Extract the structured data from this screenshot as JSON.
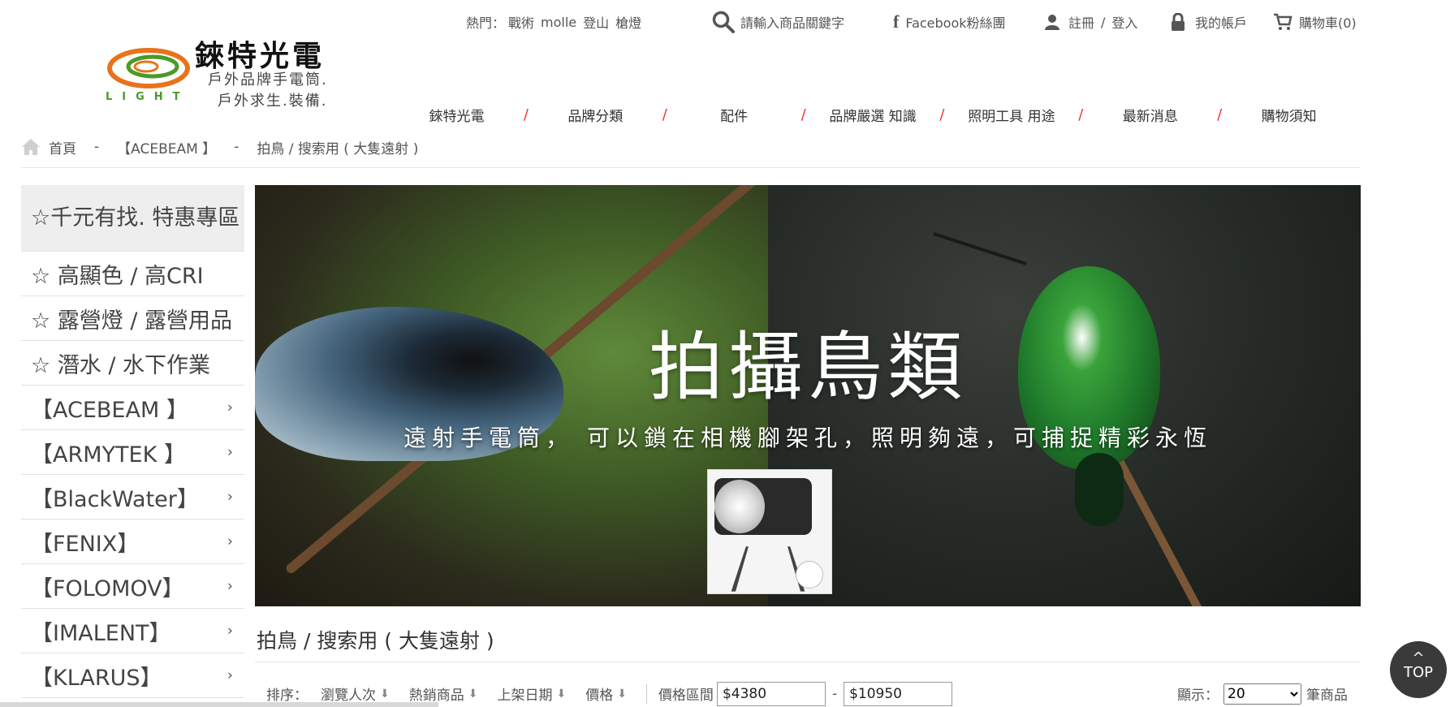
{
  "brand": {
    "name": "錸特光電",
    "tagline_1": "戶外品牌手電筒.",
    "tagline_2": "戶外求生.裝備.",
    "logo_word": "LIGHT"
  },
  "topbar": {
    "hot_label": "熱門：",
    "hot_links": [
      "戰術",
      "molle",
      "登山",
      "槍燈"
    ],
    "search_placeholder": "請輸入商品關鍵字",
    "facebook": "Facebook粉絲團",
    "register": "註冊",
    "slash": "/",
    "login": "登入",
    "account": "我的帳戶",
    "cart": "購物車(0)"
  },
  "mainnav": {
    "items": [
      "錸特光電",
      "品牌分類",
      "配件",
      "品牌嚴選 知識",
      "照明工具 用途",
      "最新消息",
      "購物須知"
    ],
    "separator": "/"
  },
  "breadcrumb": {
    "home": "首頁",
    "sep": "-",
    "level1": "【ACEBEAM 】",
    "level2": "拍鳥 / 搜索用 ( 大隻遠射 )"
  },
  "sidebar": {
    "items": [
      {
        "label": "☆千元有找. 特惠專區",
        "arrow": ""
      },
      {
        "label": "☆ 高顯色 / 高CRI",
        "arrow": ""
      },
      {
        "label": "☆ 露營燈 / 露營用品",
        "arrow": ""
      },
      {
        "label": "☆ 潛水 / 水下作業",
        "arrow": ""
      },
      {
        "label": "【ACEBEAM 】",
        "arrow": "›"
      },
      {
        "label": "【ARMYTEK 】",
        "arrow": "›"
      },
      {
        "label": "【BlackWater】",
        "arrow": "›"
      },
      {
        "label": "【FENIX】",
        "arrow": "›"
      },
      {
        "label": "【FOLOMOV】",
        "arrow": "›"
      },
      {
        "label": "【IMALENT】",
        "arrow": "›"
      },
      {
        "label": "【KLARUS】",
        "arrow": "›"
      }
    ]
  },
  "banner": {
    "title": "拍攝鳥類",
    "subtitle": "遠射手電筒， 可以鎖在相機腳架孔，照明夠遠，可捕捉精彩永恆"
  },
  "section": {
    "title": "拍鳥 / 搜索用 ( 大隻遠射 )"
  },
  "sortbar": {
    "label": "排序：",
    "options": [
      "瀏覽人次",
      "熱銷商品",
      "上架日期",
      "價格"
    ],
    "price_range_label": "價格區間",
    "price_min": "$4380",
    "price_dash": "-",
    "price_max": "$10950"
  },
  "display": {
    "label": "顯示：",
    "selected": "20",
    "suffix": "筆商品"
  },
  "top_button": {
    "caret": "^",
    "label": "TOP"
  },
  "colors": {
    "nav_separator": "#ee3333",
    "logo_orange": "#e8731c",
    "logo_green": "#4c9a2a"
  }
}
